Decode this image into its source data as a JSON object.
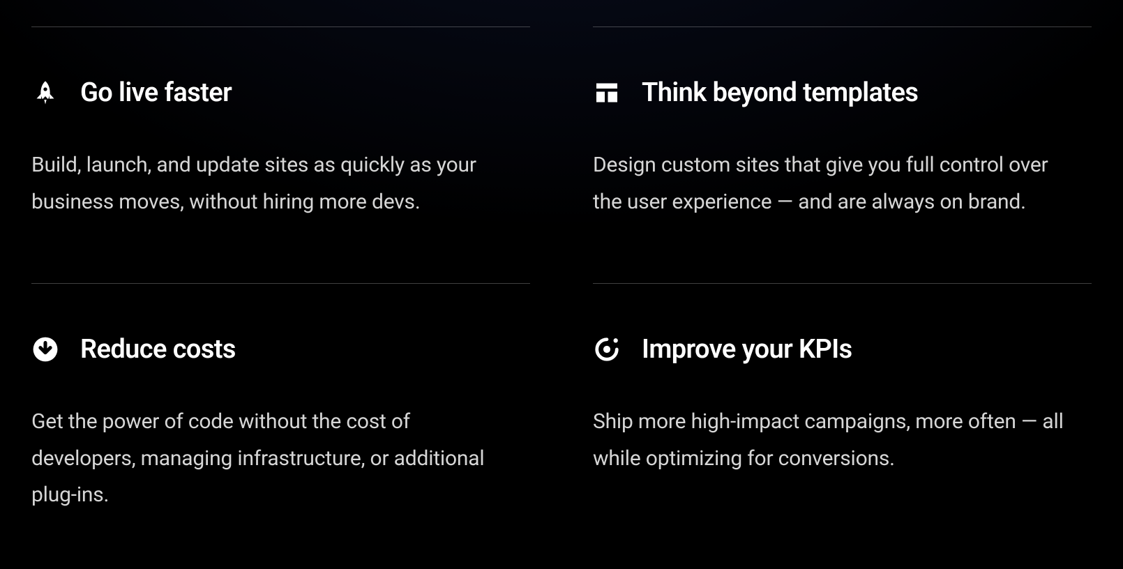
{
  "features": [
    {
      "icon": "rocket-icon",
      "title": "Go live faster",
      "desc": "Build, launch, and update sites as quickly as your business moves, without hiring more devs."
    },
    {
      "icon": "layout-icon",
      "title": "Think beyond templates",
      "desc": "Design custom sites that give you full control over the user experience — and are always on brand."
    },
    {
      "icon": "arrow-down-circle-icon",
      "title": "Reduce costs",
      "desc": "Get the power of code without the cost of developers, managing infrastructure, or additional plug-ins."
    },
    {
      "icon": "target-icon",
      "title": "Improve your KPIs",
      "desc": "Ship more high-impact campaigns, more often — all while optimizing for conversions."
    }
  ]
}
